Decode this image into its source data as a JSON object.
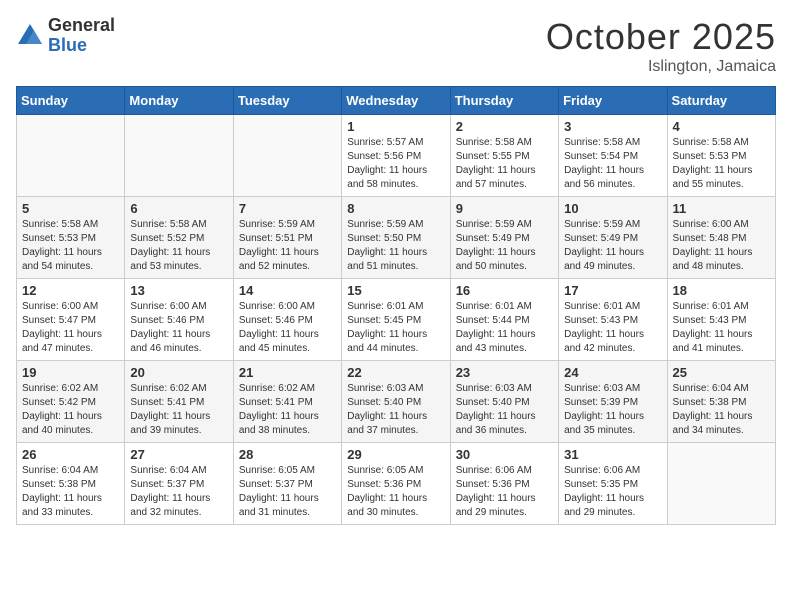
{
  "logo": {
    "general": "General",
    "blue": "Blue"
  },
  "title": "October 2025",
  "location": "Islington, Jamaica",
  "days": [
    "Sunday",
    "Monday",
    "Tuesday",
    "Wednesday",
    "Thursday",
    "Friday",
    "Saturday"
  ],
  "weeks": [
    [
      {
        "num": "",
        "info": ""
      },
      {
        "num": "",
        "info": ""
      },
      {
        "num": "",
        "info": ""
      },
      {
        "num": "1",
        "info": "Sunrise: 5:57 AM\nSunset: 5:56 PM\nDaylight: 11 hours\nand 58 minutes."
      },
      {
        "num": "2",
        "info": "Sunrise: 5:58 AM\nSunset: 5:55 PM\nDaylight: 11 hours\nand 57 minutes."
      },
      {
        "num": "3",
        "info": "Sunrise: 5:58 AM\nSunset: 5:54 PM\nDaylight: 11 hours\nand 56 minutes."
      },
      {
        "num": "4",
        "info": "Sunrise: 5:58 AM\nSunset: 5:53 PM\nDaylight: 11 hours\nand 55 minutes."
      }
    ],
    [
      {
        "num": "5",
        "info": "Sunrise: 5:58 AM\nSunset: 5:53 PM\nDaylight: 11 hours\nand 54 minutes."
      },
      {
        "num": "6",
        "info": "Sunrise: 5:58 AM\nSunset: 5:52 PM\nDaylight: 11 hours\nand 53 minutes."
      },
      {
        "num": "7",
        "info": "Sunrise: 5:59 AM\nSunset: 5:51 PM\nDaylight: 11 hours\nand 52 minutes."
      },
      {
        "num": "8",
        "info": "Sunrise: 5:59 AM\nSunset: 5:50 PM\nDaylight: 11 hours\nand 51 minutes."
      },
      {
        "num": "9",
        "info": "Sunrise: 5:59 AM\nSunset: 5:49 PM\nDaylight: 11 hours\nand 50 minutes."
      },
      {
        "num": "10",
        "info": "Sunrise: 5:59 AM\nSunset: 5:49 PM\nDaylight: 11 hours\nand 49 minutes."
      },
      {
        "num": "11",
        "info": "Sunrise: 6:00 AM\nSunset: 5:48 PM\nDaylight: 11 hours\nand 48 minutes."
      }
    ],
    [
      {
        "num": "12",
        "info": "Sunrise: 6:00 AM\nSunset: 5:47 PM\nDaylight: 11 hours\nand 47 minutes."
      },
      {
        "num": "13",
        "info": "Sunrise: 6:00 AM\nSunset: 5:46 PM\nDaylight: 11 hours\nand 46 minutes."
      },
      {
        "num": "14",
        "info": "Sunrise: 6:00 AM\nSunset: 5:46 PM\nDaylight: 11 hours\nand 45 minutes."
      },
      {
        "num": "15",
        "info": "Sunrise: 6:01 AM\nSunset: 5:45 PM\nDaylight: 11 hours\nand 44 minutes."
      },
      {
        "num": "16",
        "info": "Sunrise: 6:01 AM\nSunset: 5:44 PM\nDaylight: 11 hours\nand 43 minutes."
      },
      {
        "num": "17",
        "info": "Sunrise: 6:01 AM\nSunset: 5:43 PM\nDaylight: 11 hours\nand 42 minutes."
      },
      {
        "num": "18",
        "info": "Sunrise: 6:01 AM\nSunset: 5:43 PM\nDaylight: 11 hours\nand 41 minutes."
      }
    ],
    [
      {
        "num": "19",
        "info": "Sunrise: 6:02 AM\nSunset: 5:42 PM\nDaylight: 11 hours\nand 40 minutes."
      },
      {
        "num": "20",
        "info": "Sunrise: 6:02 AM\nSunset: 5:41 PM\nDaylight: 11 hours\nand 39 minutes."
      },
      {
        "num": "21",
        "info": "Sunrise: 6:02 AM\nSunset: 5:41 PM\nDaylight: 11 hours\nand 38 minutes."
      },
      {
        "num": "22",
        "info": "Sunrise: 6:03 AM\nSunset: 5:40 PM\nDaylight: 11 hours\nand 37 minutes."
      },
      {
        "num": "23",
        "info": "Sunrise: 6:03 AM\nSunset: 5:40 PM\nDaylight: 11 hours\nand 36 minutes."
      },
      {
        "num": "24",
        "info": "Sunrise: 6:03 AM\nSunset: 5:39 PM\nDaylight: 11 hours\nand 35 minutes."
      },
      {
        "num": "25",
        "info": "Sunrise: 6:04 AM\nSunset: 5:38 PM\nDaylight: 11 hours\nand 34 minutes."
      }
    ],
    [
      {
        "num": "26",
        "info": "Sunrise: 6:04 AM\nSunset: 5:38 PM\nDaylight: 11 hours\nand 33 minutes."
      },
      {
        "num": "27",
        "info": "Sunrise: 6:04 AM\nSunset: 5:37 PM\nDaylight: 11 hours\nand 32 minutes."
      },
      {
        "num": "28",
        "info": "Sunrise: 6:05 AM\nSunset: 5:37 PM\nDaylight: 11 hours\nand 31 minutes."
      },
      {
        "num": "29",
        "info": "Sunrise: 6:05 AM\nSunset: 5:36 PM\nDaylight: 11 hours\nand 30 minutes."
      },
      {
        "num": "30",
        "info": "Sunrise: 6:06 AM\nSunset: 5:36 PM\nDaylight: 11 hours\nand 29 minutes."
      },
      {
        "num": "31",
        "info": "Sunrise: 6:06 AM\nSunset: 5:35 PM\nDaylight: 11 hours\nand 29 minutes."
      },
      {
        "num": "",
        "info": ""
      }
    ]
  ]
}
